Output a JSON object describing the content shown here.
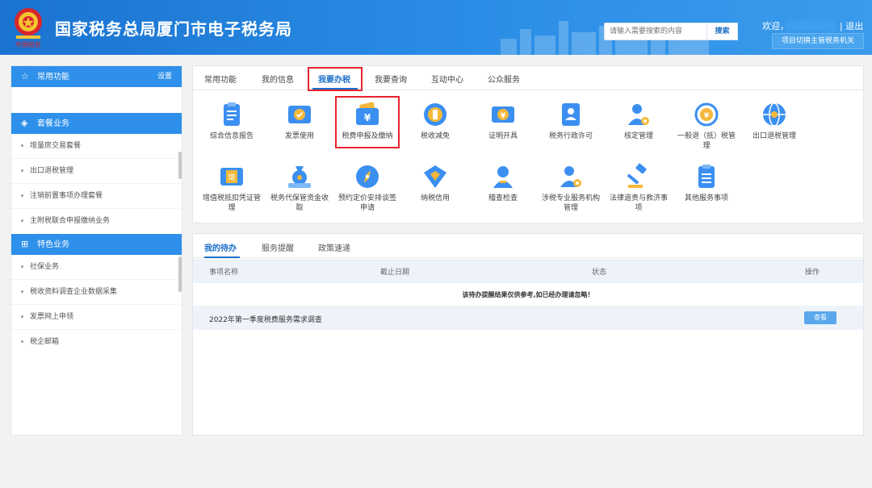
{
  "header": {
    "title": "国家税务总局厦门市电子税务局",
    "search": {
      "placeholder": "请输入需要搜索的内容",
      "button": "搜索"
    },
    "welcome": "欢迎，",
    "logout": "| 退出",
    "switch_button": "项目切换主管税务机关"
  },
  "sidebar": {
    "common": {
      "title": "常用功能",
      "settings": "设置"
    },
    "package": {
      "title": "套餐业务",
      "items": [
        "增量房交易套餐",
        "出口退税管理",
        "注销前置事项办理套餐",
        "主附税联合申报缴纳业务"
      ]
    },
    "special": {
      "title": "特色业务",
      "items": [
        "社保业务",
        "税收资料调查企业数据采集",
        "发票网上申领",
        "税企邮箱"
      ]
    }
  },
  "tabs": [
    "常用功能",
    "我的信息",
    "我要办税",
    "我要查询",
    "互动中心",
    "公众服务"
  ],
  "functions": [
    {
      "label": "综合信息报告",
      "icon": "clipboard-icon"
    },
    {
      "label": "发票使用",
      "icon": "ticket-icon"
    },
    {
      "label": "税费申报及缴纳",
      "icon": "yuan-wallet-icon"
    },
    {
      "label": "税收减免",
      "icon": "coin-icon"
    },
    {
      "label": "证明开具",
      "icon": "yuan-ticket-icon"
    },
    {
      "label": "税务行政许可",
      "icon": "id-badge-icon"
    },
    {
      "label": "核定管理",
      "icon": "user-gear-icon"
    },
    {
      "label": "一般退（抵）税管理",
      "icon": "yuan-refresh-icon"
    },
    {
      "label": "出口退税管理",
      "icon": "globe-icon"
    },
    {
      "label": "增值税抵扣凭证管理",
      "icon": "vat-ticket-icon"
    },
    {
      "label": "税务代保管资金收取",
      "icon": "money-bag-icon"
    },
    {
      "label": "预约定价安排谈签申请",
      "icon": "compass-icon"
    },
    {
      "label": "纳税信用",
      "icon": "diamond-shield-icon"
    },
    {
      "label": "稽查检查",
      "icon": "user-icon"
    },
    {
      "label": "涉税专业服务机构管理",
      "icon": "user-gear-icon"
    },
    {
      "label": "法律追责与救济事项",
      "icon": "gavel-icon"
    },
    {
      "label": "其他服务事项",
      "icon": "list-icon"
    }
  ],
  "todo": {
    "tabs": [
      "我的待办",
      "服务提醒",
      "政策速递"
    ],
    "headers": [
      "事项名称",
      "截止日期",
      "状态",
      "操作"
    ],
    "notice": "该待办提醒结果仅供参考,如已经办理请忽略！",
    "rows": [
      {
        "name": "2022年第一季度税费服务需求调查",
        "action": "查看"
      }
    ]
  },
  "colors": {
    "primary": "#2e90ea",
    "highlight": "#e8242f",
    "icon_blue": "#3b8ff0"
  }
}
